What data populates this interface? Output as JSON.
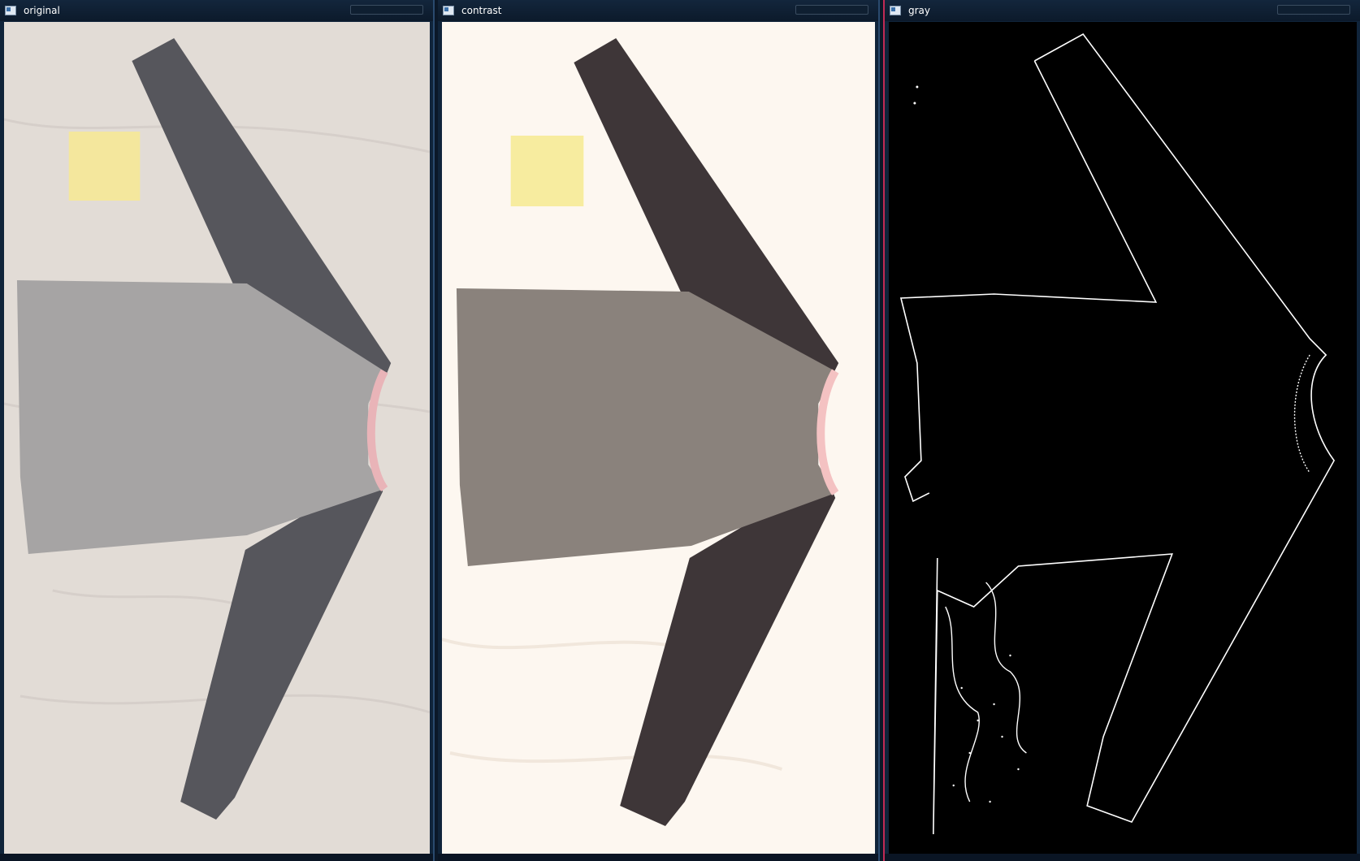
{
  "windows": [
    {
      "title": "original"
    },
    {
      "title": "contrast"
    },
    {
      "title": "gray"
    }
  ],
  "colors": {
    "background_sheet_original": "#e2dcd6",
    "background_sheet_contrast": "#fdf7f0",
    "sleeve_dark": "#56565c",
    "body_gray": "#a6a4a4",
    "note_yellow": "#f4e79d",
    "collar_pink": "#e9b4b8",
    "edge_white": "#ffffff",
    "edge_background": "#000000"
  },
  "icons": [
    "window-icon",
    "window-icon",
    "window-icon"
  ]
}
